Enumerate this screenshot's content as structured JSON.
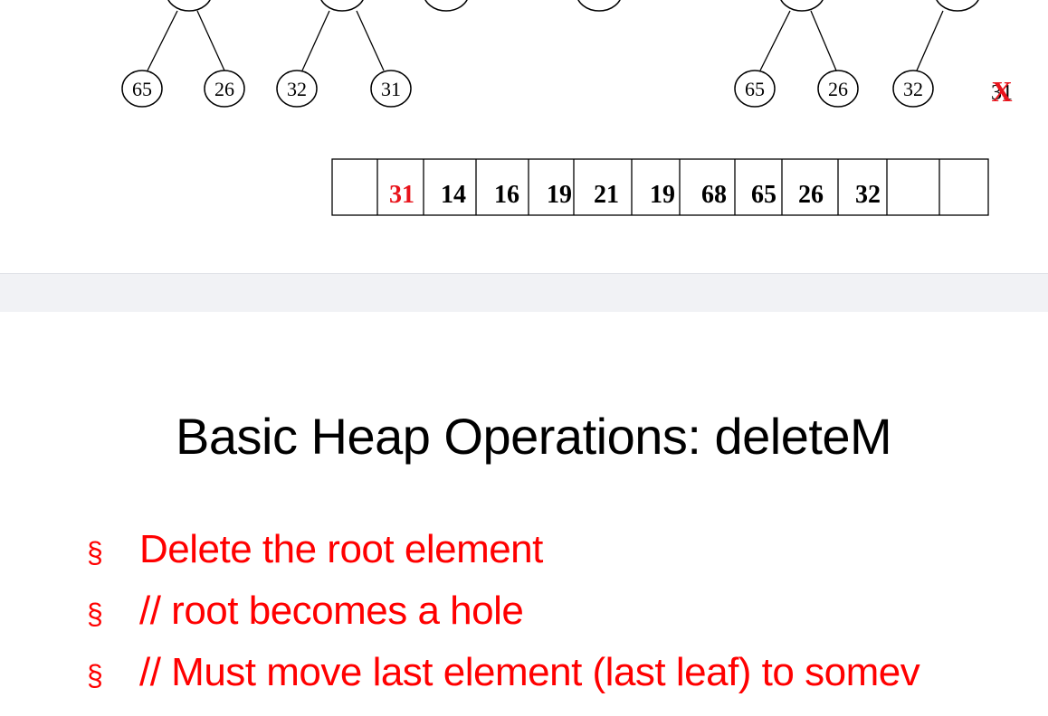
{
  "top_slide": {
    "left_tree_leaves": [
      "65",
      "26",
      "32",
      "31"
    ],
    "right_tree_leaves": [
      "65",
      "26",
      "32"
    ],
    "removed_leaf_value": "31",
    "removed_mark": "X",
    "array_cells": [
      "",
      "31",
      "14",
      "16",
      "19",
      "21",
      "19",
      "68",
      "65",
      "26",
      "32",
      "",
      ""
    ],
    "highlight_color": "#e8131b"
  },
  "slide": {
    "title": "Basic Heap Operations: deleteM",
    "bullet_marker": "§",
    "bullets": [
      "Delete the root element",
      "// root becomes a hole",
      "// Must move last element (last leaf) to somev"
    ],
    "bullet_color": "#ff0000"
  }
}
